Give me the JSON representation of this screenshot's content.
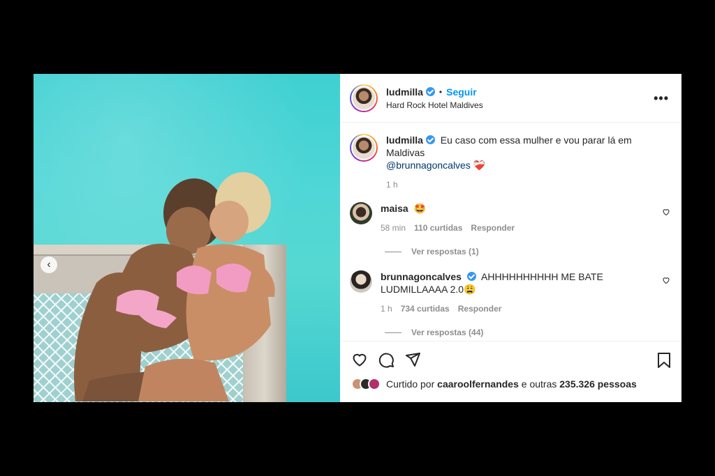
{
  "post": {
    "author": {
      "username": "ludmilla",
      "verified": true,
      "follow_label": "Seguir",
      "separator": "•",
      "location": "Hard Rock Hotel Maldives"
    },
    "more_icon": "more-horizontal-icon",
    "photo_nav_icon": "chevron-left-icon",
    "caption": {
      "username": "ludmilla",
      "text": "Eu caso com essa mulher e vou parar lá em Maldivas",
      "mention": "@brunnagoncalves",
      "emoji": "❤️‍🩹",
      "time": "1 h"
    },
    "comments": [
      {
        "username": "maisa",
        "verified": false,
        "text": "🤩",
        "time": "58 min",
        "likes": "110 curtidas",
        "reply_label": "Responder",
        "view_replies": "Ver respostas (1)"
      },
      {
        "username": "brunnagoncalves",
        "verified": true,
        "text": "AHHHHHHHHHH ME BATE LUDMILLAAAA 2.0😩",
        "time": "1 h",
        "likes": "734 curtidas",
        "reply_label": "Responder",
        "view_replies": "Ver respostas (44)"
      }
    ],
    "likes_prefix": "Curtido por",
    "likes_user": "caaroolfernandes",
    "likes_suffix": "e outras",
    "likes_count": "235.326",
    "likes_unit": "pessoas"
  },
  "colors": {
    "accent": "#0095f6",
    "verified": "#3897f0",
    "muted": "#8e8e8e",
    "heart": "#d6364a"
  }
}
